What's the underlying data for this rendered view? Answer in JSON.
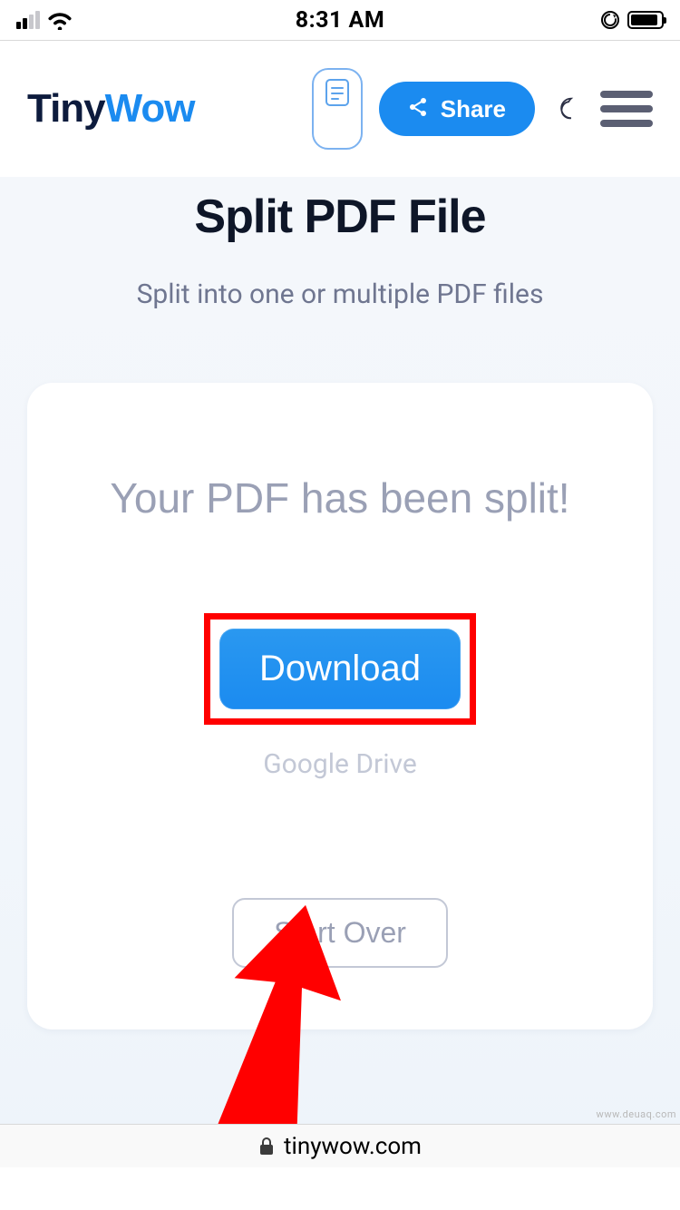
{
  "status_bar": {
    "time": "8:31 AM"
  },
  "header": {
    "logo_part1": "Tiny",
    "logo_part2": "Wow",
    "share_label": "Share"
  },
  "page": {
    "title": "Split PDF File",
    "subtitle": "Split into one or multiple PDF files"
  },
  "card": {
    "message": "Your PDF has been split!",
    "download_label": "Download",
    "google_drive_label": "Google Drive",
    "start_over_label": "Start Over"
  },
  "url_bar": {
    "domain": "tinywow.com"
  },
  "watermark": "www.deuaq.com"
}
